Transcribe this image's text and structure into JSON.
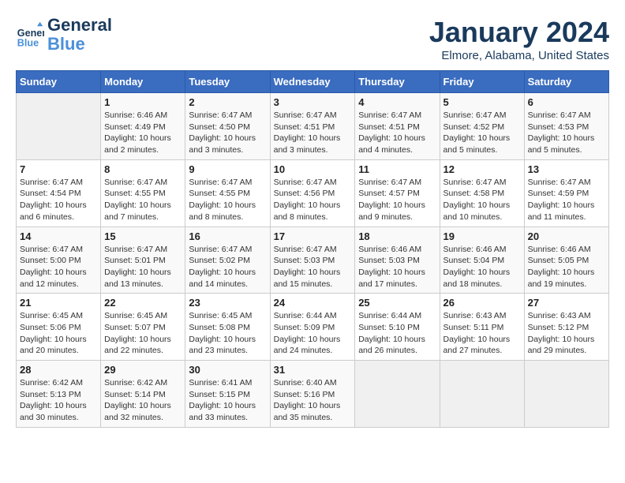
{
  "header": {
    "logo_line1": "General",
    "logo_line2": "Blue",
    "month": "January 2024",
    "location": "Elmore, Alabama, United States"
  },
  "days_of_week": [
    "Sunday",
    "Monday",
    "Tuesday",
    "Wednesday",
    "Thursday",
    "Friday",
    "Saturday"
  ],
  "weeks": [
    [
      {
        "day": "",
        "info": ""
      },
      {
        "day": "1",
        "info": "Sunrise: 6:46 AM\nSunset: 4:49 PM\nDaylight: 10 hours\nand 2 minutes."
      },
      {
        "day": "2",
        "info": "Sunrise: 6:47 AM\nSunset: 4:50 PM\nDaylight: 10 hours\nand 3 minutes."
      },
      {
        "day": "3",
        "info": "Sunrise: 6:47 AM\nSunset: 4:51 PM\nDaylight: 10 hours\nand 3 minutes."
      },
      {
        "day": "4",
        "info": "Sunrise: 6:47 AM\nSunset: 4:51 PM\nDaylight: 10 hours\nand 4 minutes."
      },
      {
        "day": "5",
        "info": "Sunrise: 6:47 AM\nSunset: 4:52 PM\nDaylight: 10 hours\nand 5 minutes."
      },
      {
        "day": "6",
        "info": "Sunrise: 6:47 AM\nSunset: 4:53 PM\nDaylight: 10 hours\nand 5 minutes."
      }
    ],
    [
      {
        "day": "7",
        "info": "Sunrise: 6:47 AM\nSunset: 4:54 PM\nDaylight: 10 hours\nand 6 minutes."
      },
      {
        "day": "8",
        "info": "Sunrise: 6:47 AM\nSunset: 4:55 PM\nDaylight: 10 hours\nand 7 minutes."
      },
      {
        "day": "9",
        "info": "Sunrise: 6:47 AM\nSunset: 4:55 PM\nDaylight: 10 hours\nand 8 minutes."
      },
      {
        "day": "10",
        "info": "Sunrise: 6:47 AM\nSunset: 4:56 PM\nDaylight: 10 hours\nand 8 minutes."
      },
      {
        "day": "11",
        "info": "Sunrise: 6:47 AM\nSunset: 4:57 PM\nDaylight: 10 hours\nand 9 minutes."
      },
      {
        "day": "12",
        "info": "Sunrise: 6:47 AM\nSunset: 4:58 PM\nDaylight: 10 hours\nand 10 minutes."
      },
      {
        "day": "13",
        "info": "Sunrise: 6:47 AM\nSunset: 4:59 PM\nDaylight: 10 hours\nand 11 minutes."
      }
    ],
    [
      {
        "day": "14",
        "info": "Sunrise: 6:47 AM\nSunset: 5:00 PM\nDaylight: 10 hours\nand 12 minutes."
      },
      {
        "day": "15",
        "info": "Sunrise: 6:47 AM\nSunset: 5:01 PM\nDaylight: 10 hours\nand 13 minutes."
      },
      {
        "day": "16",
        "info": "Sunrise: 6:47 AM\nSunset: 5:02 PM\nDaylight: 10 hours\nand 14 minutes."
      },
      {
        "day": "17",
        "info": "Sunrise: 6:47 AM\nSunset: 5:03 PM\nDaylight: 10 hours\nand 15 minutes."
      },
      {
        "day": "18",
        "info": "Sunrise: 6:46 AM\nSunset: 5:03 PM\nDaylight: 10 hours\nand 17 minutes."
      },
      {
        "day": "19",
        "info": "Sunrise: 6:46 AM\nSunset: 5:04 PM\nDaylight: 10 hours\nand 18 minutes."
      },
      {
        "day": "20",
        "info": "Sunrise: 6:46 AM\nSunset: 5:05 PM\nDaylight: 10 hours\nand 19 minutes."
      }
    ],
    [
      {
        "day": "21",
        "info": "Sunrise: 6:45 AM\nSunset: 5:06 PM\nDaylight: 10 hours\nand 20 minutes."
      },
      {
        "day": "22",
        "info": "Sunrise: 6:45 AM\nSunset: 5:07 PM\nDaylight: 10 hours\nand 22 minutes."
      },
      {
        "day": "23",
        "info": "Sunrise: 6:45 AM\nSunset: 5:08 PM\nDaylight: 10 hours\nand 23 minutes."
      },
      {
        "day": "24",
        "info": "Sunrise: 6:44 AM\nSunset: 5:09 PM\nDaylight: 10 hours\nand 24 minutes."
      },
      {
        "day": "25",
        "info": "Sunrise: 6:44 AM\nSunset: 5:10 PM\nDaylight: 10 hours\nand 26 minutes."
      },
      {
        "day": "26",
        "info": "Sunrise: 6:43 AM\nSunset: 5:11 PM\nDaylight: 10 hours\nand 27 minutes."
      },
      {
        "day": "27",
        "info": "Sunrise: 6:43 AM\nSunset: 5:12 PM\nDaylight: 10 hours\nand 29 minutes."
      }
    ],
    [
      {
        "day": "28",
        "info": "Sunrise: 6:42 AM\nSunset: 5:13 PM\nDaylight: 10 hours\nand 30 minutes."
      },
      {
        "day": "29",
        "info": "Sunrise: 6:42 AM\nSunset: 5:14 PM\nDaylight: 10 hours\nand 32 minutes."
      },
      {
        "day": "30",
        "info": "Sunrise: 6:41 AM\nSunset: 5:15 PM\nDaylight: 10 hours\nand 33 minutes."
      },
      {
        "day": "31",
        "info": "Sunrise: 6:40 AM\nSunset: 5:16 PM\nDaylight: 10 hours\nand 35 minutes."
      },
      {
        "day": "",
        "info": ""
      },
      {
        "day": "",
        "info": ""
      },
      {
        "day": "",
        "info": ""
      }
    ]
  ]
}
